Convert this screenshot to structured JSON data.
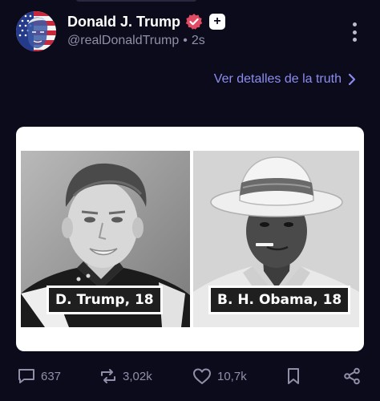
{
  "post": {
    "author_name": "Donald J. Trump",
    "handle": "@realDonaldTrump",
    "separator": "•",
    "time": "2s",
    "plus_label": "+",
    "details_link": "Ver detalles de la truth"
  },
  "media": {
    "left_caption": "D. Trump, 18",
    "right_caption": "B. H. Obama, 18"
  },
  "actions": {
    "replies": "637",
    "retruths": "3,02k",
    "likes": "10,7k"
  },
  "colors": {
    "background": "#0c0b1c",
    "verified_badge": "#e14b64",
    "link": "#8c8cf0",
    "muted": "#8f8fa7"
  }
}
